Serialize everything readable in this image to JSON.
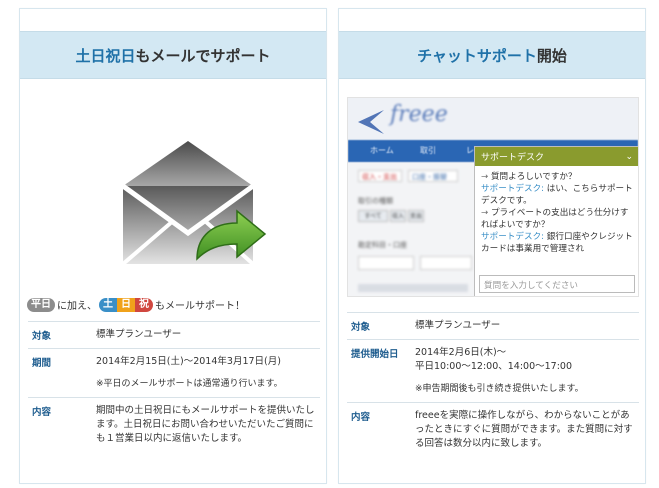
{
  "left_card": {
    "title_highlight": "土日祝日",
    "title_rest": "もメールでサポート",
    "note": {
      "badge_weekday": "平日",
      "text_after_weekday": "に加え、",
      "badge_sat": "土",
      "badge_sun": "日",
      "badge_holiday": "祝",
      "text_end": "もメールサポート！"
    },
    "rows": [
      {
        "label": "対象",
        "value": "標準プランユーザー",
        "note": ""
      },
      {
        "label": "期間",
        "value": "2014年2月15日(土)〜2014年3月17日(月)",
        "note": "※平日のメールサポートは通常通り行います。"
      },
      {
        "label": "内容",
        "value": "期間中の土日祝日にもメールサポートを提供いたします。土日祝日にお問い合わせいただいたご質問にも１営業日以内に返信いたします。",
        "note": ""
      }
    ]
  },
  "right_card": {
    "title_highlight": "チャットサポート",
    "title_rest": "開始",
    "screenshot": {
      "logo": "freee",
      "nav_items": [
        "ホーム",
        "取引",
        "レ"
      ],
      "tabs": [
        "収入・支出",
        "口座・振替"
      ],
      "labels": [
        "取引の種類",
        "すべて",
        "収入",
        "支出",
        "勘定科目・口座"
      ],
      "desk_title": "サポートデスク",
      "messages": [
        {
          "type": "q",
          "text": "質問よろしいですか？"
        },
        {
          "type": "a",
          "name": "サポートデスク:",
          "text": "はい、こちらサポートデスクです。"
        },
        {
          "type": "q",
          "text": "プライベートの支出はどう仕分けすればよいですか？"
        },
        {
          "type": "a",
          "name": "サポートデスク:",
          "text": "銀行口座やクレジットカードは事業用で管理され"
        }
      ],
      "input_placeholder": "質問を入力してください"
    },
    "rows": [
      {
        "label": "対象",
        "value": "標準プランユーザー",
        "note": ""
      },
      {
        "label": "提供開始日",
        "value": "2014年2月6日(木)〜\n平日10:00〜12:00、14:00〜17:00",
        "note": "※申告期間後も引き続き提供いたします。"
      },
      {
        "label": "内容",
        "value": "freeeを実際に操作しながら、わからないことがあったときにすぐに質問ができます。また質問に対する回答は数分以内に致します。",
        "note": ""
      }
    ]
  },
  "colors": {
    "header_bg": "#d3e8f3",
    "header_highlight": "#1f71a8",
    "label": "#1f5d8f",
    "desk_header": "#8a9b2e",
    "arrow_green": "#5da633"
  }
}
